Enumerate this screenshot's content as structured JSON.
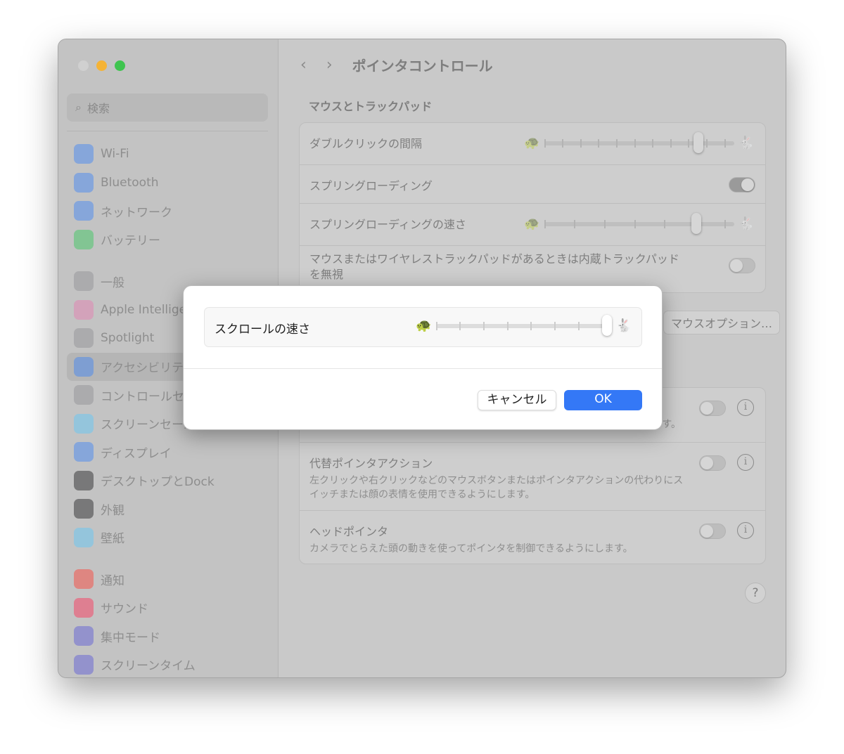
{
  "window": {
    "traffic_lights": [
      "#d0d0d0",
      "#f5b335",
      "#3fc44f"
    ]
  },
  "sidebar": {
    "search_placeholder": "検索",
    "groups": [
      [
        {
          "label": "Wi-Fi",
          "icon": "wifi-icon",
          "color": "#3b82f6"
        },
        {
          "label": "Bluetooth",
          "icon": "bluetooth-icon",
          "color": "#3b82f6"
        },
        {
          "label": "ネットワーク",
          "icon": "globe-icon",
          "color": "#3b82f6"
        },
        {
          "label": "バッテリー",
          "icon": "battery-icon",
          "color": "#34c759"
        }
      ],
      [
        {
          "label": "一般",
          "icon": "gear-icon",
          "color": "#8e8e93"
        },
        {
          "label": "Apple Intelligence & Siri",
          "icon": "apple-intelligence-icon",
          "color": "#e67ab0"
        },
        {
          "label": "Spotlight",
          "icon": "spotlight-icon",
          "color": "#8e8e93"
        },
        {
          "label": "アクセシビリティ",
          "icon": "accessibility-icon",
          "color": "#3b82f6",
          "selected": true
        },
        {
          "label": "コントロールセンター",
          "icon": "control-center-icon",
          "color": "#8e8e93"
        },
        {
          "label": "スクリーンセーバー",
          "icon": "screensaver-icon",
          "color": "#5ac8fa"
        },
        {
          "label": "ディスプレイ",
          "icon": "display-icon",
          "color": "#3b82f6"
        },
        {
          "label": "デスクトップとDock",
          "icon": "dock-icon",
          "color": "#1c1c1e"
        },
        {
          "label": "外観",
          "icon": "appearance-icon",
          "color": "#1c1c1e"
        },
        {
          "label": "壁紙",
          "icon": "wallpaper-icon",
          "color": "#5ac8fa"
        }
      ],
      [
        {
          "label": "通知",
          "icon": "bell-icon",
          "color": "#ff3b30"
        },
        {
          "label": "サウンド",
          "icon": "sound-icon",
          "color": "#ff2d55"
        },
        {
          "label": "集中モード",
          "icon": "moon-icon",
          "color": "#5856d6"
        },
        {
          "label": "スクリーンタイム",
          "icon": "hourglass-icon",
          "color": "#5856d6"
        }
      ]
    ]
  },
  "header": {
    "back": "‹",
    "forward": "›",
    "title": "ポインタコントロール"
  },
  "section1": {
    "title": "マウスとトラックパッド",
    "double_click": {
      "label": "ダブルクリックの間隔",
      "value_fraction": 0.83
    },
    "spring_loading": {
      "label": "スプリングローディング",
      "on": true
    },
    "spring_speed": {
      "label": "スプリングローディングの速さ",
      "value_fraction": 0.82
    },
    "ignore_trackpad": {
      "label": "マウスまたはワイヤレストラックパッドがあるときは内蔵トラックパッドを無視",
      "on": false
    },
    "mouse_options_button": "マウスオプション…"
  },
  "section2": {
    "hidden_desc_tail": "す。",
    "alt_pointer": {
      "label": "代替ポインタアクション",
      "desc": "左クリックや右クリックなどのマウスボタンまたはポインタアクションの代わりにスイッチまたは顔の表情を使用できるようにします。",
      "on": false
    },
    "head_pointer": {
      "label": "ヘッドポインタ",
      "desc": "カメラでとらえた頭の動きを使ってポインタを制御できるようにします。",
      "on": false
    }
  },
  "help": "?",
  "dialog": {
    "scroll_speed": {
      "label": "スクロールの速さ",
      "value_fraction": 1.0,
      "ticks": 8
    },
    "cancel": "キャンセル",
    "ok": "OK",
    "ok_color": "#3478f6"
  }
}
